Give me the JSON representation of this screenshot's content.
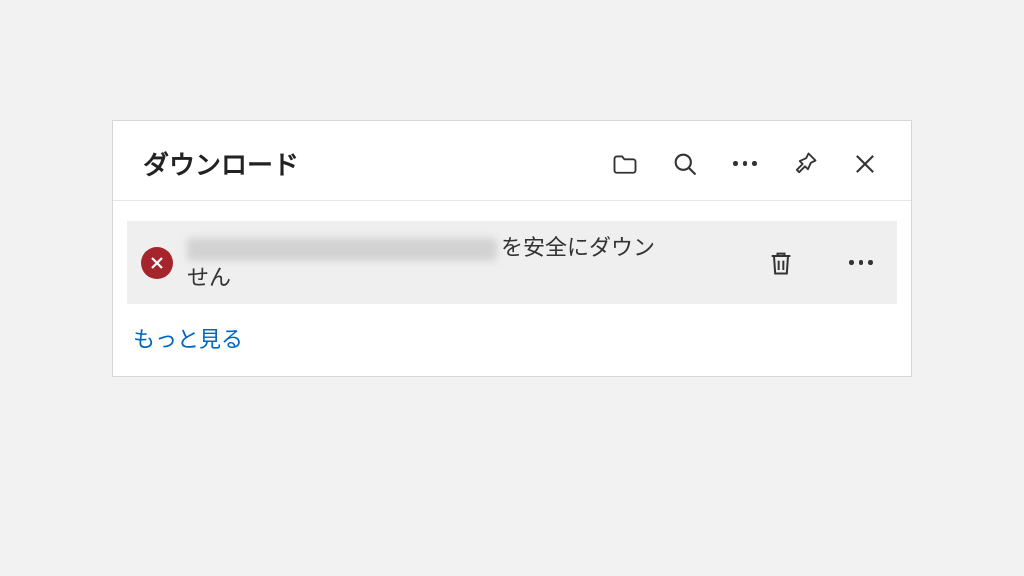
{
  "panel": {
    "title": "ダウンロード"
  },
  "item": {
    "message_suffix_line1": "を安全にダウン",
    "message_line2": "せん"
  },
  "footer": {
    "more_link": "もっと見る"
  },
  "colors": {
    "error_badge": "#a4262c",
    "link": "#0067c0",
    "panel_bg": "#ffffff",
    "page_bg": "#f2f2f2",
    "item_bg": "#efefef"
  }
}
